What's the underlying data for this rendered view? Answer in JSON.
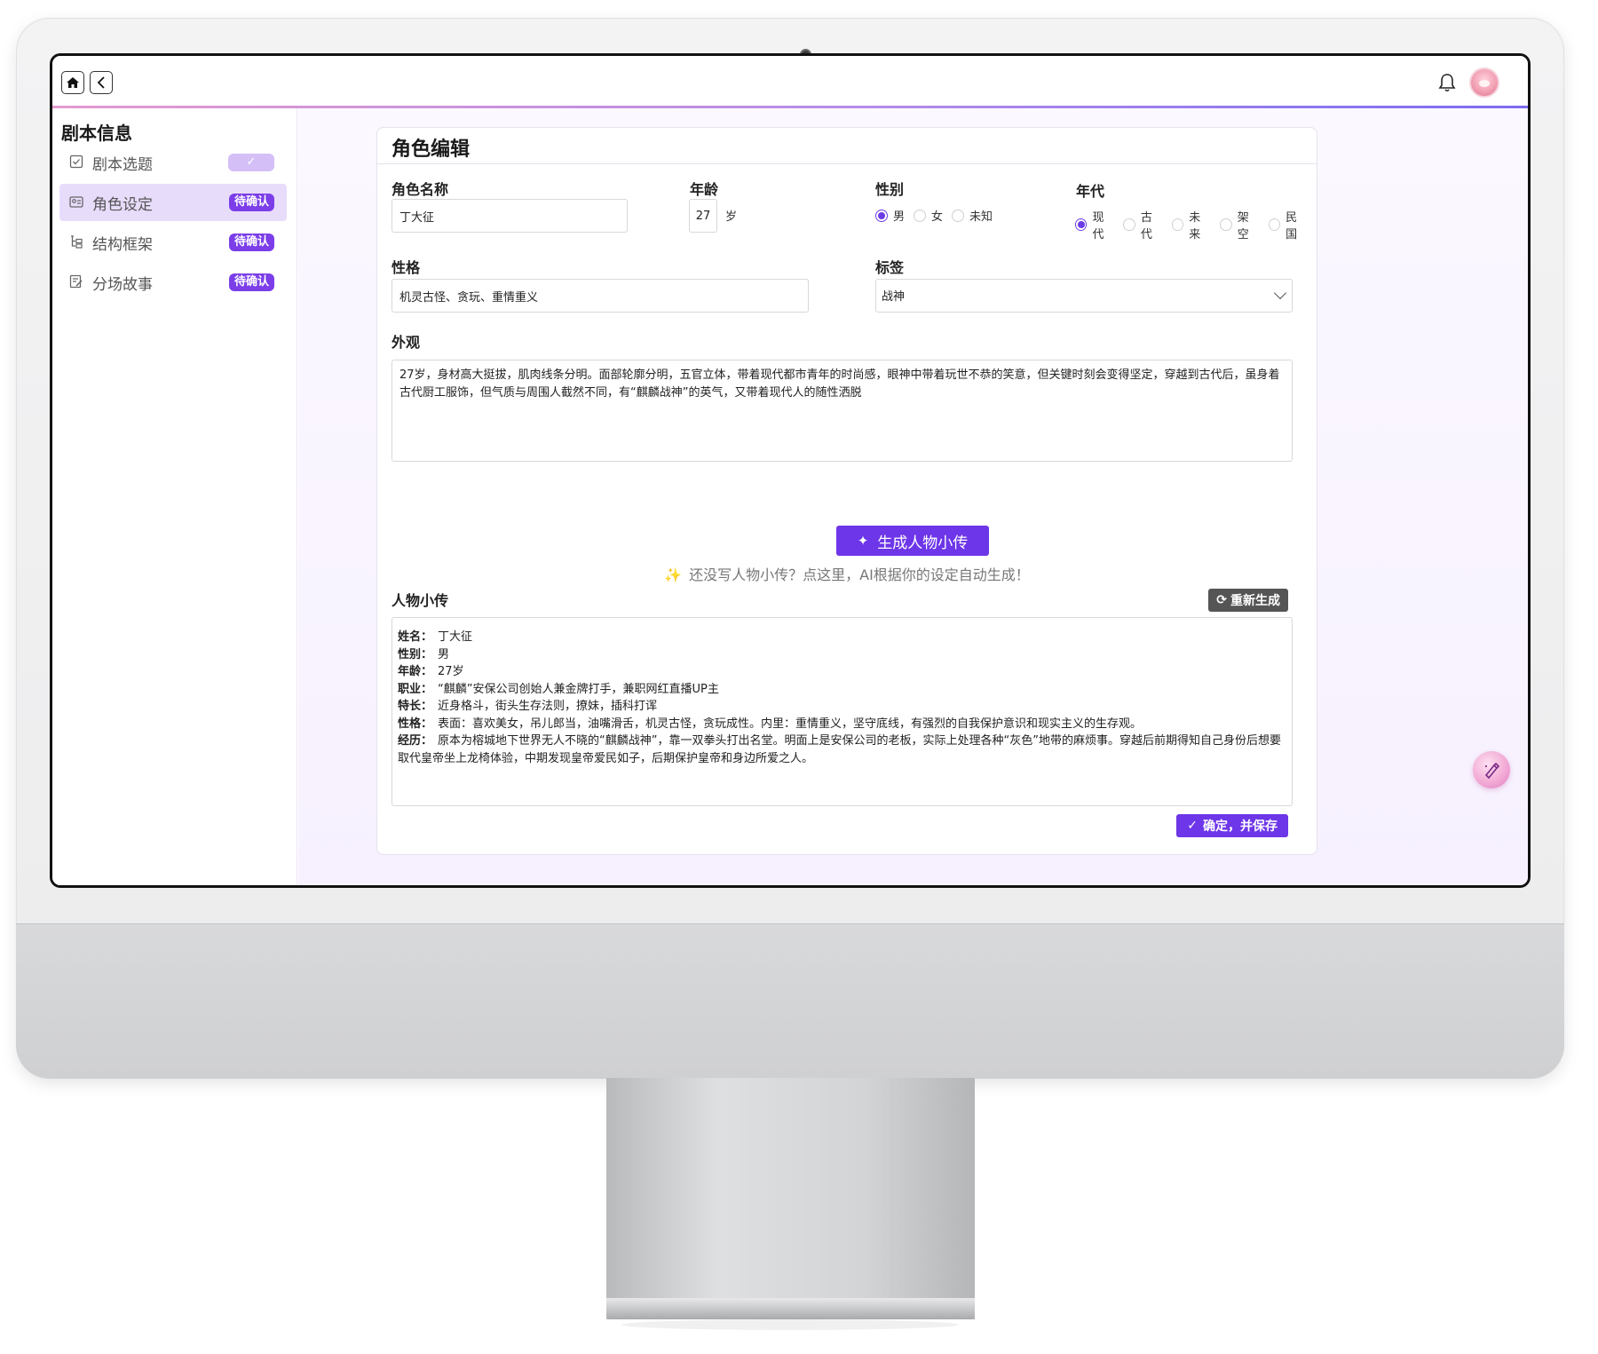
{
  "sidebar": {
    "title": "剧本信息",
    "items": [
      {
        "label": "剧本选题",
        "icon": "checklist-icon",
        "badge": "✓",
        "status": "done"
      },
      {
        "label": "角色设定",
        "icon": "character-icon",
        "badge": "待确认",
        "status": "pending",
        "active": true
      },
      {
        "label": "结构框架",
        "icon": "structure-icon",
        "badge": "待确认",
        "status": "pending"
      },
      {
        "label": "分场故事",
        "icon": "scene-edit-icon",
        "badge": "待确认",
        "status": "pending"
      }
    ]
  },
  "card": {
    "title": "角色编辑",
    "fields": {
      "name": {
        "label": "角色名称",
        "value": "丁大征"
      },
      "age": {
        "label": "年龄",
        "value": "27",
        "suffix": "岁"
      },
      "gender": {
        "label": "性别",
        "options": [
          "男",
          "女",
          "未知"
        ],
        "selected": "男"
      },
      "era": {
        "label": "年代",
        "options": [
          "现代",
          "古代",
          "未来",
          "架空",
          "民国"
        ],
        "selected": "现代"
      },
      "personality": {
        "label": "性格",
        "value": "机灵古怪、贪玩、重情重义"
      },
      "tags": {
        "label": "标签",
        "value": "战神"
      },
      "appearance": {
        "label": "外观",
        "value": "27岁，身材高大挺拔，肌肉线条分明。面部轮廓分明，五官立体，带着现代都市青年的时尚感，眼神中带着玩世不恭的笑意，但关键时刻会变得坚定，穿越到古代后，虽身着古代厨工服饰，但气质与周围人截然不同，有“麒麟战神”的英气，又带着现代人的随性洒脱"
      }
    },
    "generate_button": "生成人物小传",
    "hint": "还没写人物小传？点这里，AI根据你的设定自动生成！",
    "bio": {
      "label": "人物小传",
      "regenerate_button": "重新生成",
      "lines": [
        {
          "key": "姓名：",
          "value": "丁大征"
        },
        {
          "key": "性别：",
          "value": "男"
        },
        {
          "key": "年龄：",
          "value": "27岁"
        },
        {
          "key": "职业：",
          "value": "“麒麟”安保公司创始人兼金牌打手，兼职网红直播UP主"
        },
        {
          "key": "特长：",
          "value": "近身格斗，街头生存法则，撩妹，插科打诨"
        },
        {
          "key": "性格：",
          "value": "表面：喜欢美女，吊儿郎当，油嘴滑舌，机灵古怪，贪玩成性。内里：重情重义，坚守底线，有强烈的自我保护意识和现实主义的生存观。"
        },
        {
          "key": "经历：",
          "value": "原本为榕城地下世界无人不晓的“麒麟战神”，靠一双拳头打出名堂。明面上是安保公司的老板，实际上处理各种“灰色”地带的麻烦事。穿越后前期得知自己身份后想要取代皇帝坐上龙椅体验，中期发现皇帝爱民如子，后期保护皇帝和身边所爱之人。"
        }
      ]
    },
    "save_button": "确定，并保存"
  },
  "colors": {
    "accent": "#6d36e8",
    "active_nav": "#e8dcfb",
    "badge_pending": "#7b3ee8",
    "badge_done": "#d4bff7"
  }
}
